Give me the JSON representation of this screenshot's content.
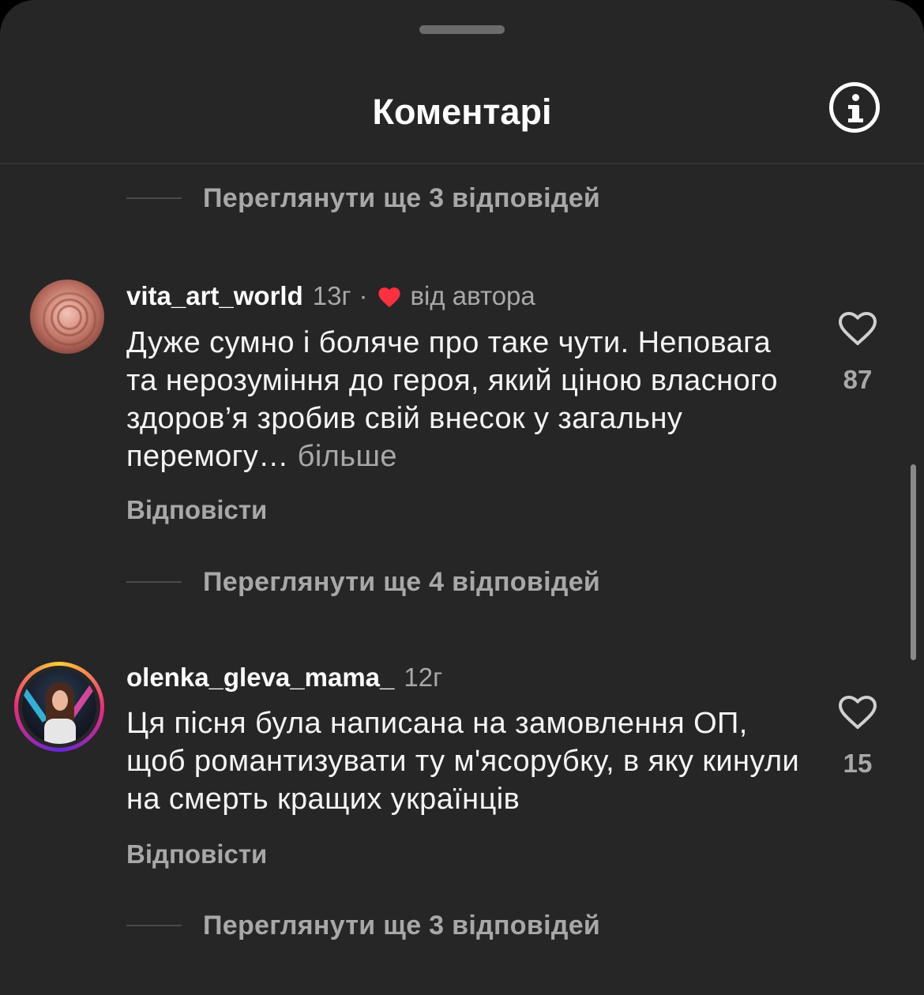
{
  "header": {
    "title": "Коментарі"
  },
  "threads": [
    {
      "view_replies": "Переглянути ще 3 відповідей"
    },
    {
      "view_replies": "Переглянути ще 4 відповідей"
    },
    {
      "view_replies": "Переглянути ще 3 відповідей"
    }
  ],
  "comments": [
    {
      "username": "vita_art_world",
      "time": "13г",
      "separator": "·",
      "liked_by_author_label": "від автора",
      "text": "Дуже сумно і боляче про таке чути. Неповага та нерозуміння до героя, який ціною власного здоров’я зробив свій внесок у загальну перемогу…",
      "more_label": "більше",
      "reply_label": "Відповісти",
      "likes": "87"
    },
    {
      "username": "olenka_gleva_mama_",
      "time": "12г",
      "text": "Ця пісня була написана на замовлення ОП, щоб романтизувати ту м'ясорубку, в яку кинули на смерть кращих українців",
      "reply_label": "Відповісти",
      "likes": "15"
    }
  ],
  "colors": {
    "background": "#262626",
    "text_primary": "#ffffff",
    "text_secondary": "#a8a8a8",
    "author_heart": "#ff3040"
  },
  "icons": {
    "info": "info-circle-icon",
    "like": "heart-outline-icon",
    "author_like": "heart-filled-icon"
  }
}
